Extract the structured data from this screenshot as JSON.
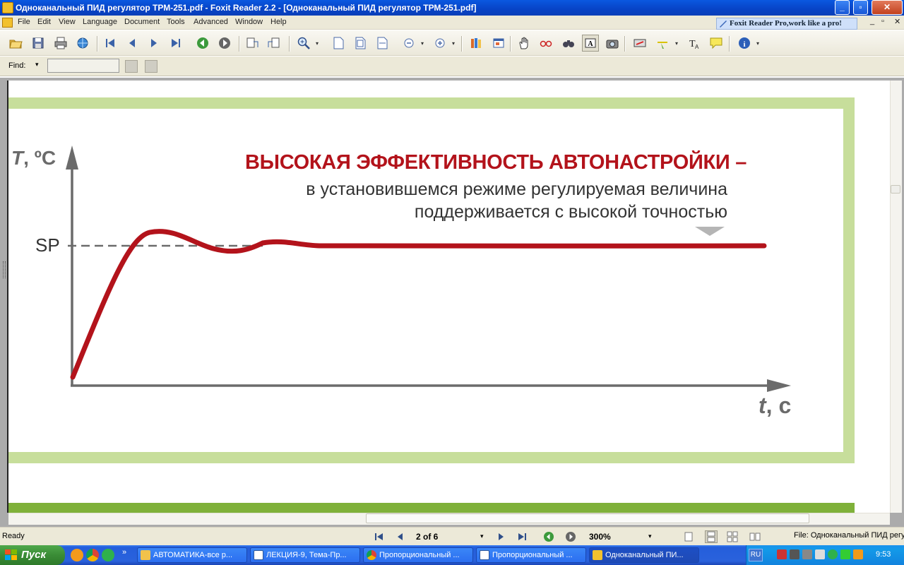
{
  "window": {
    "title": "Одноканальный ПИД рeгулятор ТРМ-251.pdf - Foxit Reader 2.2 - [Одноканальный ПИД рeгулятор ТРМ-251.pdf]"
  },
  "menu": [
    "File",
    "Edit",
    "View",
    "Language",
    "Document",
    "Tools",
    "Advanced",
    "Window",
    "Help"
  ],
  "promo": "Foxit Reader Pro,work like a pro!",
  "find": {
    "label": "Find:",
    "value": ""
  },
  "document": {
    "headline": "ВЫСОКАЯ ЭФФЕКТИВНОСТЬ АВТОНАСТРОЙКИ –",
    "line1": "в установившемся режиме регулируемая величина",
    "line2": "поддерживается с высокой точностью",
    "y_axis": "T, °C",
    "y_axis_t": "T",
    "y_axis_unit": ", ºC",
    "x_axis_t": "t",
    "x_axis_unit": ", c",
    "sp_label": "SP",
    "colors": {
      "green_frame": "#c7de9b",
      "accent_red": "#b3131b",
      "axis_gray": "#666666",
      "bottom_band": "#7fb13a"
    }
  },
  "status": {
    "ready": "Ready",
    "page": "2 of 6",
    "zoom": "300%",
    "file": "File: Одноканальный ПИД регу"
  },
  "taskbar": {
    "start": "Пуск",
    "tasks": [
      {
        "label": "АВТОМАТИКА-все р...",
        "icon": "folder-icon"
      },
      {
        "label": "ЛЕКЦИЯ-9, Тема-Пр...",
        "icon": "word-icon"
      },
      {
        "label": "Пропорциональный ...",
        "icon": "chrome-icon"
      },
      {
        "label": "Пропорциональный ...",
        "icon": "word-icon"
      },
      {
        "label": "Одноканальный ПИ...",
        "icon": "foxit-icon"
      }
    ],
    "lang": "RU",
    "clock": "9:53"
  }
}
